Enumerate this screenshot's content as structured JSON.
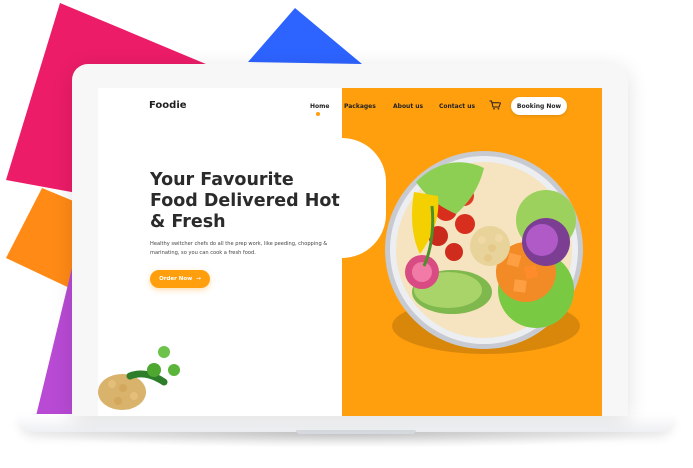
{
  "nav": {
    "logo": "Foodie",
    "items": [
      "Home",
      "Packages",
      "About us",
      "Contact us"
    ],
    "active_item": "Home",
    "booking_button": "Booking Now",
    "cart_icon": "cart-icon"
  },
  "hero": {
    "title": "Your Favourite Food Delivered Hot & Fresh",
    "description": "Healthy switcher chefs do all the prep work, like peeding, chopping & marinating, so you can cook a fresh food.",
    "cta": "Order Now",
    "cta_arrow": "→"
  },
  "colors": {
    "accent": "#ff9f0e",
    "pink": "#ec1c68",
    "blue": "#2d63ff",
    "purple": "#b84ad4",
    "text": "#2b2b2b"
  }
}
